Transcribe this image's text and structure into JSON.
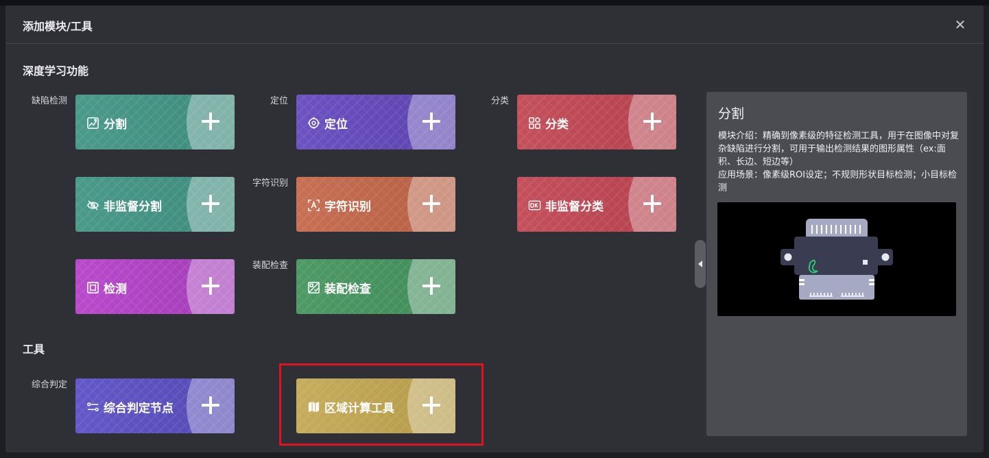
{
  "dialog": {
    "title": "添加模块/工具",
    "close_symbol": "✕"
  },
  "sections": {
    "deep_learning": "深度学习功能",
    "tools": "工具"
  },
  "row_labels": {
    "defect": "缺陷检测",
    "locate": "定位",
    "classify": "分类",
    "ocr": "字符识别",
    "assembly": "装配检查",
    "judge": "综合判定"
  },
  "cards": {
    "segment": {
      "label": "分割",
      "icon": "segment-image-icon",
      "color": "#4a9a8a"
    },
    "locate": {
      "label": "定位",
      "icon": "target-icon",
      "color": "#6d52c2"
    },
    "classify": {
      "label": "分类",
      "icon": "grid-classify-icon",
      "color": "#c4505c"
    },
    "unsup_segment": {
      "label": "非监督分割",
      "icon": "eye-off-icon",
      "color": "#4a9a8a"
    },
    "ocr": {
      "label": "字符识别",
      "icon": "text-scan-icon",
      "color": "#c86f54"
    },
    "unsup_classify": {
      "label": "非监督分类",
      "icon": "ok-badge-icon",
      "color": "#c4505c"
    },
    "detect": {
      "label": "检测",
      "icon": "detect-box-icon",
      "color": "#b94acb"
    },
    "assembly": {
      "label": "装配检查",
      "icon": "assembly-check-icon",
      "color": "#4e9a66"
    },
    "judge_node": {
      "label": "综合判定节点",
      "icon": "sliders-icon",
      "color": "#6358c8"
    },
    "area_calc": {
      "label": "区域计算工具",
      "icon": "map-icon",
      "color": "#c6ac5c"
    }
  },
  "info": {
    "title": "分割",
    "description": "模块介绍：精确到像素级的特征检测工具，用于在图像中对复杂缺陷进行分割，可用于输出检测结果的图形属性（ex:面积、长边、短边等）",
    "scenario": "应用场景：像素级ROI设定；不规则形状目标检测；小目标检测"
  }
}
